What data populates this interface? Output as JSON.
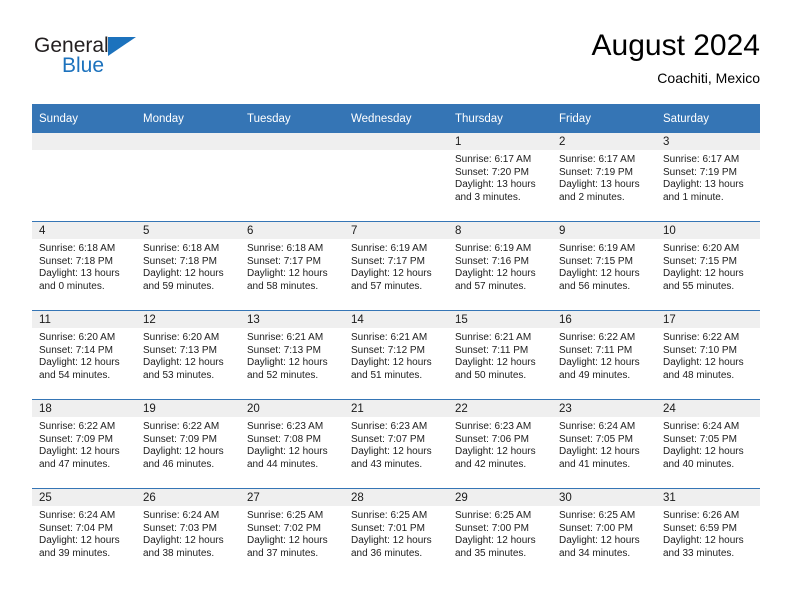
{
  "brand": {
    "name_top": "General",
    "name_bottom": "Blue",
    "triangle_color": "#1c72bd",
    "text_color": "#231f20"
  },
  "header": {
    "title": "August 2024",
    "subtitle": "Coachiti, Mexico"
  },
  "theme": {
    "header_blue": "#3575b5",
    "daynum_band": "#efefef",
    "cell_background": "#ffffff",
    "text": "#202020"
  },
  "weekdays": [
    "Sunday",
    "Monday",
    "Tuesday",
    "Wednesday",
    "Thursday",
    "Friday",
    "Saturday"
  ],
  "weeks": [
    [
      {
        "day": "",
        "sunrise": "",
        "sunset": "",
        "daylight1": "",
        "daylight2": ""
      },
      {
        "day": "",
        "sunrise": "",
        "sunset": "",
        "daylight1": "",
        "daylight2": ""
      },
      {
        "day": "",
        "sunrise": "",
        "sunset": "",
        "daylight1": "",
        "daylight2": ""
      },
      {
        "day": "",
        "sunrise": "",
        "sunset": "",
        "daylight1": "",
        "daylight2": ""
      },
      {
        "day": "1",
        "sunrise": "Sunrise: 6:17 AM",
        "sunset": "Sunset: 7:20 PM",
        "daylight1": "Daylight: 13 hours",
        "daylight2": "and 3 minutes."
      },
      {
        "day": "2",
        "sunrise": "Sunrise: 6:17 AM",
        "sunset": "Sunset: 7:19 PM",
        "daylight1": "Daylight: 13 hours",
        "daylight2": "and 2 minutes."
      },
      {
        "day": "3",
        "sunrise": "Sunrise: 6:17 AM",
        "sunset": "Sunset: 7:19 PM",
        "daylight1": "Daylight: 13 hours",
        "daylight2": "and 1 minute."
      }
    ],
    [
      {
        "day": "4",
        "sunrise": "Sunrise: 6:18 AM",
        "sunset": "Sunset: 7:18 PM",
        "daylight1": "Daylight: 13 hours",
        "daylight2": "and 0 minutes."
      },
      {
        "day": "5",
        "sunrise": "Sunrise: 6:18 AM",
        "sunset": "Sunset: 7:18 PM",
        "daylight1": "Daylight: 12 hours",
        "daylight2": "and 59 minutes."
      },
      {
        "day": "6",
        "sunrise": "Sunrise: 6:18 AM",
        "sunset": "Sunset: 7:17 PM",
        "daylight1": "Daylight: 12 hours",
        "daylight2": "and 58 minutes."
      },
      {
        "day": "7",
        "sunrise": "Sunrise: 6:19 AM",
        "sunset": "Sunset: 7:17 PM",
        "daylight1": "Daylight: 12 hours",
        "daylight2": "and 57 minutes."
      },
      {
        "day": "8",
        "sunrise": "Sunrise: 6:19 AM",
        "sunset": "Sunset: 7:16 PM",
        "daylight1": "Daylight: 12 hours",
        "daylight2": "and 57 minutes."
      },
      {
        "day": "9",
        "sunrise": "Sunrise: 6:19 AM",
        "sunset": "Sunset: 7:15 PM",
        "daylight1": "Daylight: 12 hours",
        "daylight2": "and 56 minutes."
      },
      {
        "day": "10",
        "sunrise": "Sunrise: 6:20 AM",
        "sunset": "Sunset: 7:15 PM",
        "daylight1": "Daylight: 12 hours",
        "daylight2": "and 55 minutes."
      }
    ],
    [
      {
        "day": "11",
        "sunrise": "Sunrise: 6:20 AM",
        "sunset": "Sunset: 7:14 PM",
        "daylight1": "Daylight: 12 hours",
        "daylight2": "and 54 minutes."
      },
      {
        "day": "12",
        "sunrise": "Sunrise: 6:20 AM",
        "sunset": "Sunset: 7:13 PM",
        "daylight1": "Daylight: 12 hours",
        "daylight2": "and 53 minutes."
      },
      {
        "day": "13",
        "sunrise": "Sunrise: 6:21 AM",
        "sunset": "Sunset: 7:13 PM",
        "daylight1": "Daylight: 12 hours",
        "daylight2": "and 52 minutes."
      },
      {
        "day": "14",
        "sunrise": "Sunrise: 6:21 AM",
        "sunset": "Sunset: 7:12 PM",
        "daylight1": "Daylight: 12 hours",
        "daylight2": "and 51 minutes."
      },
      {
        "day": "15",
        "sunrise": "Sunrise: 6:21 AM",
        "sunset": "Sunset: 7:11 PM",
        "daylight1": "Daylight: 12 hours",
        "daylight2": "and 50 minutes."
      },
      {
        "day": "16",
        "sunrise": "Sunrise: 6:22 AM",
        "sunset": "Sunset: 7:11 PM",
        "daylight1": "Daylight: 12 hours",
        "daylight2": "and 49 minutes."
      },
      {
        "day": "17",
        "sunrise": "Sunrise: 6:22 AM",
        "sunset": "Sunset: 7:10 PM",
        "daylight1": "Daylight: 12 hours",
        "daylight2": "and 48 minutes."
      }
    ],
    [
      {
        "day": "18",
        "sunrise": "Sunrise: 6:22 AM",
        "sunset": "Sunset: 7:09 PM",
        "daylight1": "Daylight: 12 hours",
        "daylight2": "and 47 minutes."
      },
      {
        "day": "19",
        "sunrise": "Sunrise: 6:22 AM",
        "sunset": "Sunset: 7:09 PM",
        "daylight1": "Daylight: 12 hours",
        "daylight2": "and 46 minutes."
      },
      {
        "day": "20",
        "sunrise": "Sunrise: 6:23 AM",
        "sunset": "Sunset: 7:08 PM",
        "daylight1": "Daylight: 12 hours",
        "daylight2": "and 44 minutes."
      },
      {
        "day": "21",
        "sunrise": "Sunrise: 6:23 AM",
        "sunset": "Sunset: 7:07 PM",
        "daylight1": "Daylight: 12 hours",
        "daylight2": "and 43 minutes."
      },
      {
        "day": "22",
        "sunrise": "Sunrise: 6:23 AM",
        "sunset": "Sunset: 7:06 PM",
        "daylight1": "Daylight: 12 hours",
        "daylight2": "and 42 minutes."
      },
      {
        "day": "23",
        "sunrise": "Sunrise: 6:24 AM",
        "sunset": "Sunset: 7:05 PM",
        "daylight1": "Daylight: 12 hours",
        "daylight2": "and 41 minutes."
      },
      {
        "day": "24",
        "sunrise": "Sunrise: 6:24 AM",
        "sunset": "Sunset: 7:05 PM",
        "daylight1": "Daylight: 12 hours",
        "daylight2": "and 40 minutes."
      }
    ],
    [
      {
        "day": "25",
        "sunrise": "Sunrise: 6:24 AM",
        "sunset": "Sunset: 7:04 PM",
        "daylight1": "Daylight: 12 hours",
        "daylight2": "and 39 minutes."
      },
      {
        "day": "26",
        "sunrise": "Sunrise: 6:24 AM",
        "sunset": "Sunset: 7:03 PM",
        "daylight1": "Daylight: 12 hours",
        "daylight2": "and 38 minutes."
      },
      {
        "day": "27",
        "sunrise": "Sunrise: 6:25 AM",
        "sunset": "Sunset: 7:02 PM",
        "daylight1": "Daylight: 12 hours",
        "daylight2": "and 37 minutes."
      },
      {
        "day": "28",
        "sunrise": "Sunrise: 6:25 AM",
        "sunset": "Sunset: 7:01 PM",
        "daylight1": "Daylight: 12 hours",
        "daylight2": "and 36 minutes."
      },
      {
        "day": "29",
        "sunrise": "Sunrise: 6:25 AM",
        "sunset": "Sunset: 7:00 PM",
        "daylight1": "Daylight: 12 hours",
        "daylight2": "and 35 minutes."
      },
      {
        "day": "30",
        "sunrise": "Sunrise: 6:25 AM",
        "sunset": "Sunset: 7:00 PM",
        "daylight1": "Daylight: 12 hours",
        "daylight2": "and 34 minutes."
      },
      {
        "day": "31",
        "sunrise": "Sunrise: 6:26 AM",
        "sunset": "Sunset: 6:59 PM",
        "daylight1": "Daylight: 12 hours",
        "daylight2": "and 33 minutes."
      }
    ]
  ]
}
